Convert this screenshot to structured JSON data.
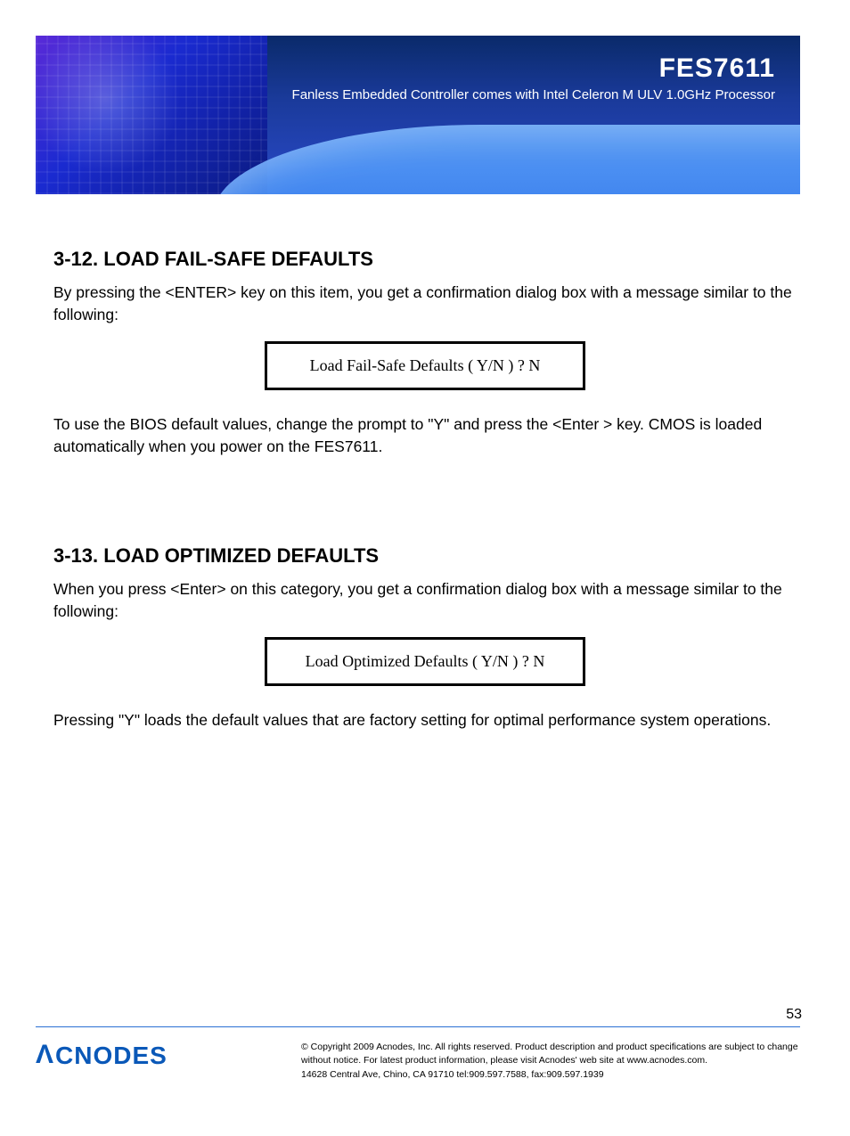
{
  "banner": {
    "model": "FES7611",
    "sub": "Fanless Embedded Controller comes with Intel Celeron M ULV 1.0GHz Processor"
  },
  "section1": {
    "heading": "3-12. LOAD FAIL-SAFE DEFAULTS",
    "para1": "By pressing the <ENTER> key on this item, you get a confirmation dialog box with a message similar to the following:",
    "prompt": "Load Fail-Safe Defaults ( Y/N ) ? N",
    "para2": "To use the BIOS default values, change the prompt to \"Y\" and press the <Enter > key. CMOS is loaded automatically when you power on the FES7611."
  },
  "section2": {
    "heading": "3-13. LOAD OPTIMIZED DEFAULTS",
    "para1": "When you press <Enter> on this category, you get a confirmation dialog box with a message similar to the following:",
    "prompt": "Load Optimized Defaults ( Y/N ) ? N",
    "para2": "Pressing \"Y\" loads the default values that are factory setting for optimal performance system operations."
  },
  "footer": {
    "copyright": "© Copyright 2009 Acnodes, Inc. All rights reserved. Product description and product specifications are subject to change without notice. For latest product information, please visit Acnodes' web site at www.acnodes.com.",
    "address": "14628 Central Ave, Chino, CA 91710 tel:909.597.7588, fax:909.597.1939"
  },
  "page_number": "53"
}
